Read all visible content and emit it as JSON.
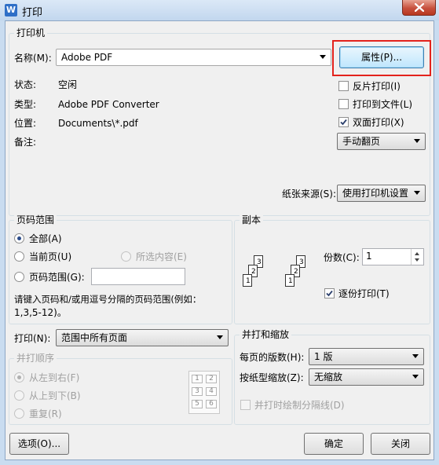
{
  "window": {
    "title": "打印",
    "app_icon_glyph": "W"
  },
  "printer": {
    "group_title": "打印机",
    "name_label": "名称(M):",
    "name_value": "Adobe PDF",
    "properties_label": "属性(P)...",
    "status_label": "状态:",
    "status_value": "空闲",
    "type_label": "类型:",
    "type_value": "Adobe PDF Converter",
    "location_label": "位置:",
    "location_value": "Documents\\*.pdf",
    "comment_label": "备注:",
    "reverse_print_label": "反片打印(I)",
    "reverse_print_checked": false,
    "print_to_file_label": "打印到文件(L)",
    "print_to_file_checked": false,
    "duplex_label": "双面打印(X)",
    "duplex_checked": true,
    "duplex_mode_value": "手动翻页",
    "paper_source_label": "纸张来源(S):",
    "paper_source_value": "使用打印机设置"
  },
  "page_range": {
    "group_title": "页码范围",
    "all_label": "全部(A)",
    "current_label": "当前页(U)",
    "selection_label": "所选内容(E)",
    "range_label": "页码范围(G):",
    "range_value": "",
    "hint_line1": "请键入页码和/或用逗号分隔的页码范围(例如：",
    "hint_line2": "1,3,5-12)。",
    "selected": "all"
  },
  "copies": {
    "group_title": "副本",
    "count_label": "份数(C):",
    "count_value": "1",
    "collate_label": "逐份打印(T)",
    "collate_checked": true,
    "stack_a": [
      "3",
      "2",
      "1"
    ],
    "stack_b": [
      "3",
      "2",
      "1"
    ]
  },
  "print_what": {
    "label": "打印(N):",
    "value": "范围中所有页面"
  },
  "page_order": {
    "group_title": "并打顺序",
    "left_to_right": "从左到右(F)",
    "top_to_bottom": "从上到下(B)",
    "repeat": "重复(R)",
    "grid": [
      "1",
      "2",
      "3",
      "4",
      "5",
      "6"
    ]
  },
  "zoom": {
    "group_title": "并打和缩放",
    "pages_per_sheet_label": "每页的版数(H):",
    "pages_per_sheet_value": "1 版",
    "scale_label": "按纸型缩放(Z):",
    "scale_value": "无缩放",
    "draw_borders_label": "并打时绘制分隔线(D)"
  },
  "footer": {
    "options_label": "选项(O)...",
    "ok_label": "确定",
    "close_label": "关闭"
  }
}
